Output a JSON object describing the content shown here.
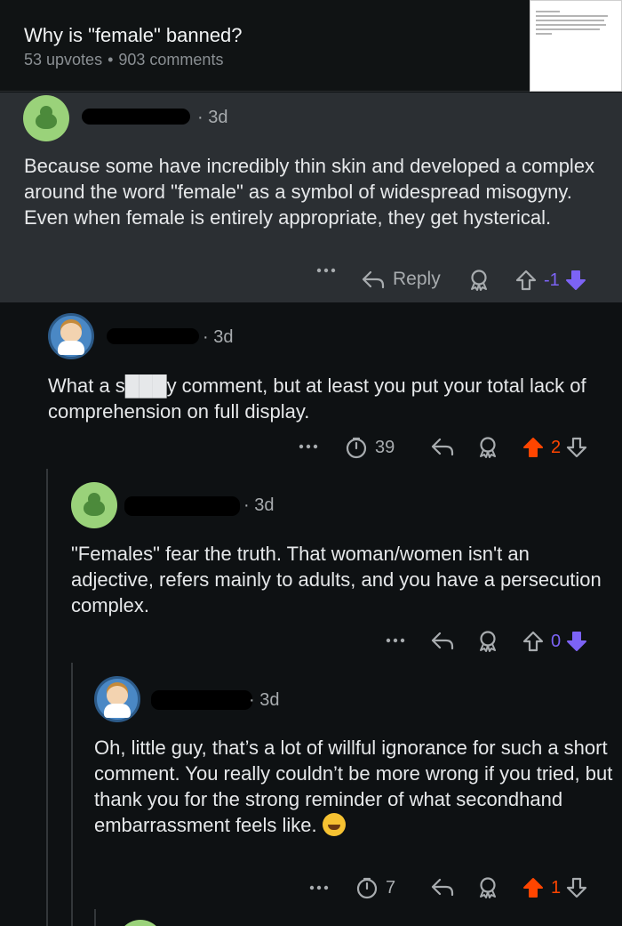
{
  "post": {
    "title": "Why is \"female\" banned?",
    "upvotes": "53 upvotes",
    "comments": "903 comments"
  },
  "comments": [
    {
      "time": "3d",
      "body": "Because some have incredibly thin skin and developed a complex around the word \"female\" as a symbol of widespread misogyny. Even when female is entirely appropriate, they get hysterical.",
      "reply_label": "Reply",
      "votes": "-1"
    },
    {
      "time": "3d",
      "body": "What a s███y comment, but at least you put your total lack of comprehension on full display.",
      "awards": "39",
      "votes": "2"
    },
    {
      "time": "3d",
      "body": "\"Females\" fear the truth. That woman/women isn't an adjective, refers mainly to adults, and you have a persecution complex.",
      "votes": "0"
    },
    {
      "time": "3d",
      "body": "Oh, little guy, that’s a lot of willful ignorance for such a short comment. You really couldn’t be more wrong if you tried, but thank you for the strong reminder of what secondhand embarrassment feels like.",
      "awards": "7",
      "votes": "1"
    }
  ],
  "icons": [
    "more-icon",
    "reply-icon",
    "award-icon",
    "upvote-icon",
    "downvote-icon",
    "timer-icon",
    "laughing-emoji-icon"
  ],
  "colors": {
    "upvote_active": "#ff4500",
    "downvote_active": "#7c63f5",
    "background": "#0e1113",
    "highlight": "#2b2f33"
  }
}
